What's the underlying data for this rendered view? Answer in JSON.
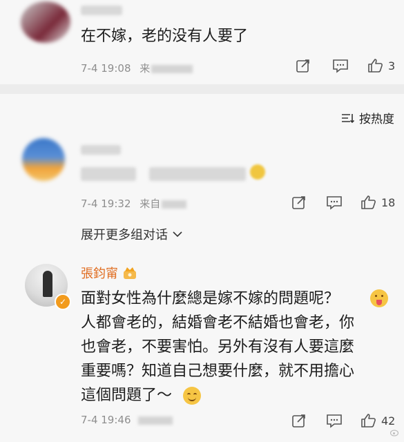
{
  "comment1": {
    "text": "在不嫁，老的没有人要了",
    "time": "7-4 19:08",
    "source_prefix": "来",
    "like_count": "3"
  },
  "sort": {
    "label": "按热度"
  },
  "comment2": {
    "time": "7-4 19:32",
    "source_prefix": "来自",
    "like_count": "18"
  },
  "expand": {
    "label": "展开更多组对话"
  },
  "comment3": {
    "username": "張鈞甯",
    "lines": [
      "面對女性為什麼總是嫁不嫁的問題呢？",
      "人都會老的，結婚會老不結婚也會老，你",
      "也會老，不要害怕。另外有沒有人要這麼",
      "重要嗎？知道自己想要什麼，就不用擔心",
      "這個問題了～"
    ],
    "time": "7-4 19:46",
    "like_count": "42"
  },
  "colors": {
    "accent_name": "#e06c1f",
    "meta": "#8e8e8e",
    "background": "#f7f7f7"
  }
}
